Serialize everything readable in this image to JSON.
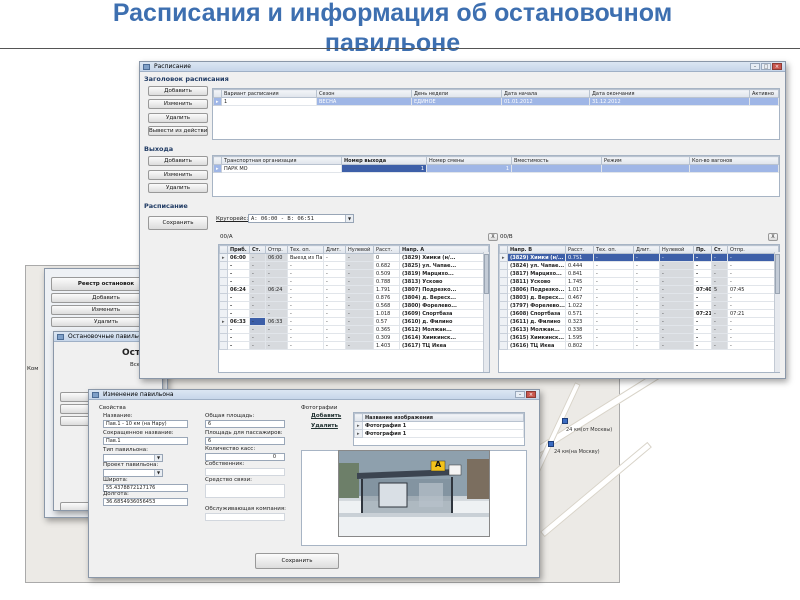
{
  "slide": {
    "title_line1": "Расписания и информация об остановочном",
    "title_line2": "павильоне"
  },
  "schedule_window": {
    "title": "Расписание",
    "header_section": "Заголовок расписания",
    "btn_add": "Добавить",
    "btn_edit": "Изменить",
    "btn_delete": "Удалить",
    "btn_deactivate": "Вывести из действия",
    "variants_columns": [
      "Вариант расписания",
      "Сезон",
      "День недели",
      "Дата начала",
      "Дата окончания",
      "Активно"
    ],
    "variants_row": [
      "1",
      "ВЕСНА",
      "ЕДИНОЕ",
      "01.01.2012",
      "31.12.2012",
      ""
    ],
    "exits_section": "Выхода",
    "exits_columns": [
      "Транспортная организация",
      "Номер выхода",
      "Номер смены",
      "Вместимость",
      "Режим",
      "Кол-во вагонов"
    ],
    "exits_row": [
      "ПАРК МО",
      "1",
      "1",
      "",
      "",
      ""
    ],
    "schedule_section": "Расписание",
    "btn_save": "Сохранить",
    "circuit_label": "Кругорейс:",
    "circuit_value": "А: 06:00 - В: 06:51",
    "dir_a_label": "00/А",
    "dir_b_label": "00/В",
    "x_label": "X",
    "grid_a_columns": [
      "Приб.",
      "Ст.",
      "Отпр.",
      "Тех. оп.",
      "Длит.",
      "Нулевой",
      "Расст.",
      "Напр. А"
    ],
    "grid_a_rows": [
      [
        "06:00",
        "-",
        "06:00",
        "Выезд из Па...",
        "-",
        "-",
        "0",
        "(3829) Химки (н/..."
      ],
      [
        "-",
        "-",
        "-",
        "-",
        "-",
        "-",
        "0.682",
        "(3825) ул. Чапае..."
      ],
      [
        "-",
        "-",
        "-",
        "-",
        "-",
        "-",
        "0.509",
        "(3819) Марцихо..."
      ],
      [
        "-",
        "-",
        "-",
        "-",
        "-",
        "-",
        "0.788",
        "(3813) Усково"
      ],
      [
        "06:24",
        "-",
        "06:24",
        "-",
        "-",
        "-",
        "1.791",
        "(3807) Подрезко..."
      ],
      [
        "-",
        "-",
        "-",
        "-",
        "-",
        "-",
        "0.876",
        "(3804) д. Вересх..."
      ],
      [
        "-",
        "-",
        "-",
        "-",
        "-",
        "-",
        "0.568",
        "(3800) Форелево..."
      ],
      [
        "-",
        "-",
        "-",
        "-",
        "-",
        "-",
        "1.018",
        "(3609) Спортбаза"
      ],
      [
        "06:33",
        "-",
        "06:33",
        "-",
        "-",
        "-",
        "0.57",
        "(3610) д. Филино"
      ],
      [
        "-",
        "-",
        "-",
        "-",
        "-",
        "-",
        "0.365",
        "(3612) Молжан..."
      ],
      [
        "-",
        "-",
        "-",
        "-",
        "-",
        "-",
        "0.309",
        "(3614) Химкинск..."
      ],
      [
        "-",
        "-",
        "-",
        "-",
        "-",
        "-",
        "1.403",
        "(3617) ТЦ Икеа"
      ]
    ],
    "grid_b_columns": [
      "Напр. В",
      "Расст.",
      "Тех. оп.",
      "Длит.",
      "Нулевой",
      "Пр.",
      "Ст.",
      "Отпр."
    ],
    "grid_b_rows": [
      [
        "(3829) Химки (н/...",
        "0.751",
        "-",
        "-",
        "-",
        "-",
        "-",
        "-"
      ],
      [
        "(3824) ул. Чапае...",
        "0.444",
        "-",
        "-",
        "-",
        "-",
        "-",
        "-"
      ],
      [
        "(3817) Марцихо...",
        "0.841",
        "-",
        "-",
        "-",
        "-",
        "-",
        "-"
      ],
      [
        "(3811) Усково",
        "1.745",
        "-",
        "-",
        "-",
        "-",
        "-",
        "-"
      ],
      [
        "(3806) Подрезко...",
        "1.017",
        "-",
        "-",
        "-",
        "07:40",
        "5",
        "07:45"
      ],
      [
        "(3803) д. Вересх...",
        "0.467",
        "-",
        "-",
        "-",
        "-",
        "-",
        "-"
      ],
      [
        "(3797) Форелево...",
        "1.022",
        "-",
        "-",
        "-",
        "-",
        "-",
        "-"
      ],
      [
        "(3608) Спортбаза",
        "0.571",
        "-",
        "-",
        "-",
        "07:21",
        "-",
        "07:21"
      ],
      [
        "(3611) д. Филино",
        "0.323",
        "-",
        "-",
        "-",
        "-",
        "-",
        "-"
      ],
      [
        "(3613) Молжан...",
        "0.338",
        "-",
        "-",
        "-",
        "-",
        "-",
        "-"
      ],
      [
        "(3615) Химкинск...",
        "1.595",
        "-",
        "-",
        "-",
        "-",
        "-",
        "-"
      ],
      [
        "(3616) ТЦ Икеа",
        "0.802",
        "-",
        "-",
        "-",
        "-",
        "-",
        "-"
      ]
    ]
  },
  "stops_window": {
    "title": "Реестр остановок",
    "btn_add": "Добавить",
    "btn_edit": "Изменить",
    "btn_delete": "Удалить",
    "sub_title": "Остановочные павильоны",
    "sub_heading": "Ост",
    "sub_all": "Всег",
    "side_label": "Ком"
  },
  "pavilion_window": {
    "title": "Изменение павильона",
    "props_label": "Свойства",
    "name_label": "Название:",
    "name_value": "Пав.1 - 10 км (на Нару)",
    "short_label": "Сокращенное название:",
    "short_value": "Пав.1",
    "type_label": "Тип павильона:",
    "project_label": "Проект павильона:",
    "lat_label": "Широта:",
    "lat_value": "55.4378872127176",
    "lon_label": "Долгота:",
    "lon_value": "36.6854936056453",
    "area_label": "Общая площадь:",
    "area_value": "6",
    "pass_area_label": "Площадь для пассажиров:",
    "pass_area_value": "6",
    "kassa_label": "Количество касс:",
    "kassa_value": "0",
    "owner_label": "Собственник:",
    "comm_label": "Средство связи:",
    "service_label": "Обслуживающая компания:",
    "photos_label": "Фотографии",
    "add_link": "Добавить",
    "delete_link": "Удалить",
    "photo_col": "Название изображения",
    "photo_rows": [
      "Фотография 1",
      "Фотография 1"
    ],
    "btn_save": "Сохранить",
    "sign_letter": "А"
  },
  "map": {
    "labels": [
      "24 км(от Москвы)",
      "24 км(на Москву)"
    ]
  },
  "colors": {
    "title": "#3d6fb0",
    "selection": "#3d5fa8",
    "section": "#1f3a63"
  }
}
